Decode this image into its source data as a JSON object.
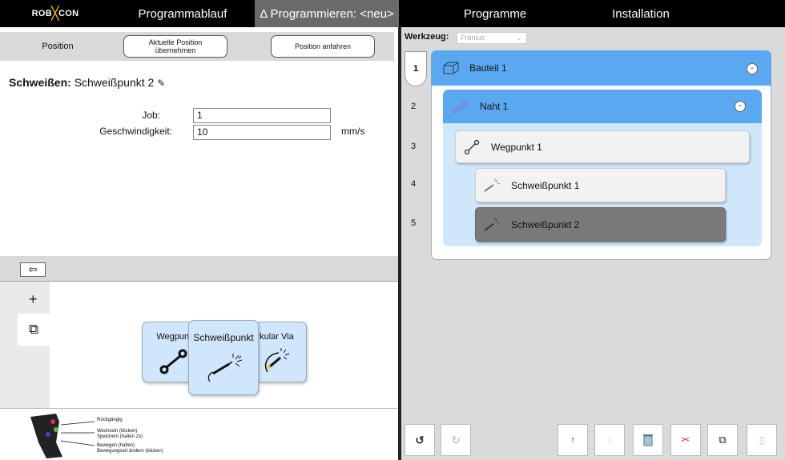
{
  "nav": {
    "logo": "ROBXCON",
    "tabs": [
      "Programmablauf",
      "Δ Programmieren: <neu>",
      "Programme",
      "Installation"
    ]
  },
  "position_bar": {
    "label": "Position",
    "take_position": "Aktuelle Position übernehmen",
    "move_to": "Position anfahren"
  },
  "node_header": {
    "type": "Schweißen:",
    "name": "Schweißpunkt 2",
    "edit_icon": "pencil-icon"
  },
  "form": {
    "job_label": "Job:",
    "job_value": "1",
    "speed_label": "Geschwindigkeit:",
    "speed_value": "10",
    "speed_unit": "mm/s"
  },
  "back_button": "⇦",
  "left_tabs": [
    "+",
    "⧉"
  ],
  "cards": [
    "Wegpunkt",
    "Schweißpunkt",
    "Zirkular Via"
  ],
  "pendant_hints": [
    "Rückgängig",
    "Wechseln (klicken)",
    "Speichern (halten 2s)",
    "Bewegen (halten)",
    "Bewegungsart ändern (klicken)"
  ],
  "tool": {
    "label": "Werkzeug:",
    "selected": "Fronius"
  },
  "tree": {
    "row_numbers": [
      "1",
      "2",
      "3",
      "4",
      "5"
    ],
    "nodes": [
      "Bauteil 1",
      "Naht 1",
      "Wegpunkt 1",
      "Schweißpunkt 1",
      "Schweißpunkt 2"
    ],
    "collapse_symbol": "-"
  },
  "toolbar": {
    "undo": "↺",
    "redo": "↻",
    "up": "↑",
    "down": "↓",
    "delete": "trash-icon",
    "cut": "scissors-icon",
    "copy": "copy-icon",
    "paste": "paste-icon"
  },
  "colors": {
    "selected_blue": "#5aa9f0",
    "light_blue": "#cfe6fb",
    "selected_gray": "#7a7a7a"
  }
}
